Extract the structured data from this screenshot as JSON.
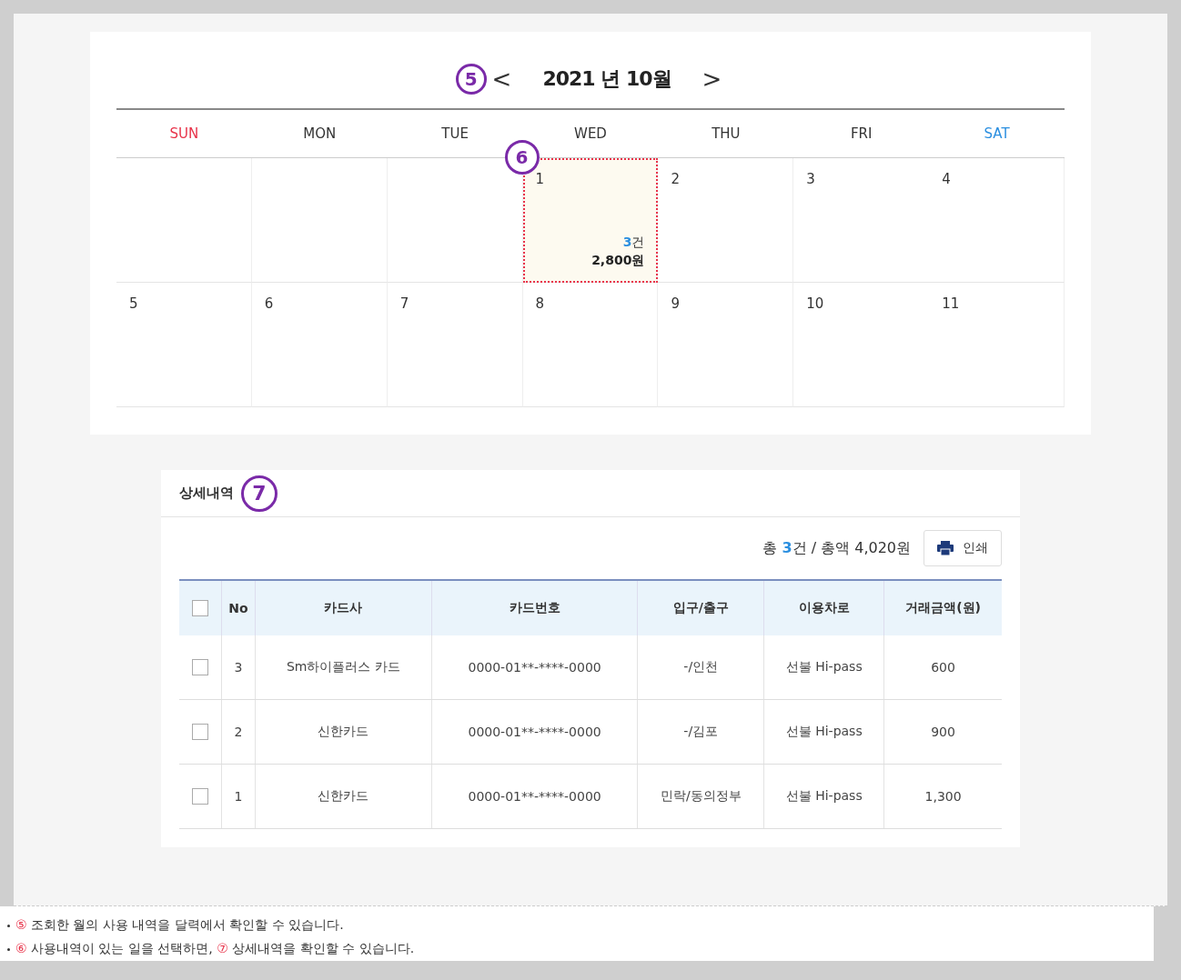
{
  "calendar": {
    "callout": "5",
    "title": "2021 년 10월",
    "prev": "<",
    "next": ">",
    "weekdays": [
      {
        "label": "SUN",
        "color": "#e8334a"
      },
      {
        "label": "MON",
        "color": "#333333"
      },
      {
        "label": "TUE",
        "color": "#333333"
      },
      {
        "label": "WED",
        "color": "#333333"
      },
      {
        "label": "THU",
        "color": "#333333"
      },
      {
        "label": "FRI",
        "color": "#333333"
      },
      {
        "label": "SAT",
        "color": "#2b8fe0"
      }
    ],
    "day_callout": "6",
    "weeks": [
      [
        {
          "kind": "blank"
        },
        {
          "kind": "blank"
        },
        {
          "kind": "blank"
        },
        {
          "kind": "day",
          "day": "1",
          "selected": true,
          "count": "3",
          "count_unit": "건",
          "amount": "2,800원"
        },
        {
          "kind": "day",
          "day": "2",
          "selected": false
        },
        {
          "kind": "day",
          "day": "3",
          "selected": false
        },
        {
          "kind": "day",
          "day": "4",
          "selected": false
        }
      ],
      [
        {
          "kind": "day",
          "day": "5",
          "selected": false
        },
        {
          "kind": "day",
          "day": "6",
          "selected": false
        },
        {
          "kind": "day",
          "day": "7",
          "selected": false
        },
        {
          "kind": "day",
          "day": "8",
          "selected": false
        },
        {
          "kind": "day",
          "day": "9",
          "selected": false
        },
        {
          "kind": "day",
          "day": "10",
          "selected": false
        },
        {
          "kind": "day",
          "day": "11",
          "selected": false
        }
      ]
    ]
  },
  "details": {
    "title": "상세내역",
    "callout": "7",
    "summary_prefix": "총 ",
    "summary_count": "3",
    "summary_rest": "건 / 총액 4,020원",
    "print_button": "인쇄",
    "columns": [
      "No",
      "카드사",
      "카드번호",
      "입구/출구",
      "이용차로",
      "거래금액(원)"
    ],
    "header_checked": false,
    "rows": [
      {
        "checked": false,
        "cells": [
          "3",
          "Sm하이플러스 카드",
          "0000-01**-****-0000",
          "-/인천",
          "선불 Hi-pass",
          "600"
        ]
      },
      {
        "checked": false,
        "cells": [
          "2",
          "신한카드",
          "0000-01**-****-0000",
          "-/김포",
          "선불 Hi-pass",
          "900"
        ]
      },
      {
        "checked": false,
        "cells": [
          "1",
          "신한카드",
          "0000-01**-****-0000",
          "민락/동의정부",
          "선불 Hi-pass",
          "1,300"
        ]
      }
    ]
  },
  "notes": [
    [
      {
        "kind": "marker",
        "text": "⑤"
      },
      {
        "kind": "text",
        "text": " 조회한 월의 사용 내역을 달력에서 확인할 수 있습니다."
      }
    ],
    [
      {
        "kind": "marker",
        "text": "⑥"
      },
      {
        "kind": "text",
        "text": " 사용내역이 있는 일을 선택하면, "
      },
      {
        "kind": "marker",
        "text": "⑦"
      },
      {
        "kind": "text",
        "text": " 상세내역을 확인할 수 있습니다."
      }
    ]
  ]
}
